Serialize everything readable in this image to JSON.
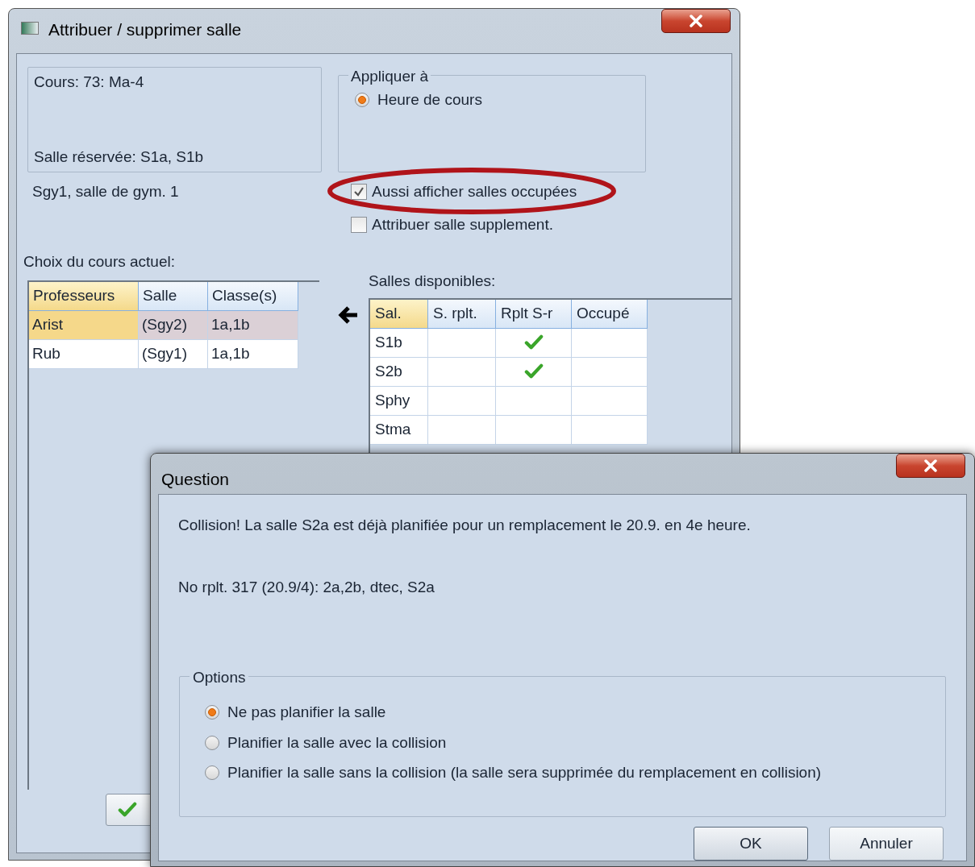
{
  "window": {
    "title": "Attribuer / supprimer salle"
  },
  "course_box": {
    "course": "Cours: 73: Ma-4",
    "reserved": "Salle réservée: S1a, S1b"
  },
  "room_note": "Sgy1, salle de gym. 1",
  "apply_to": {
    "legend": "Appliquer à",
    "options": [
      {
        "label": "Heure de cours",
        "selected": true
      }
    ]
  },
  "checkboxes": [
    {
      "label": "Aussi afficher salles occupées",
      "checked": true,
      "highlighted": true
    },
    {
      "label": "Attribuer salle supplement.",
      "checked": false,
      "highlighted": false
    }
  ],
  "current_course": {
    "label": "Choix du cours actuel:",
    "columns": [
      "Professeurs",
      "Salle",
      "Classe(s)"
    ],
    "rows": [
      {
        "cells": [
          "Arist",
          "(Sgy2)",
          "1a,1b"
        ],
        "selected": true
      },
      {
        "cells": [
          "Rub",
          "(Sgy1)",
          "1a,1b"
        ],
        "selected": false
      }
    ]
  },
  "available_rooms": {
    "label": "Salles disponibles:",
    "columns": [
      "Sal.",
      "S. rplt.",
      "Rplt S-r",
      "Occupé"
    ],
    "rows": [
      {
        "name": "S1b",
        "rplt": false,
        "rplt_sr": true,
        "occupied": false
      },
      {
        "name": "S2b",
        "rplt": false,
        "rplt_sr": true,
        "occupied": false
      },
      {
        "name": "Sphy",
        "rplt": false,
        "rplt_sr": false,
        "occupied": false
      },
      {
        "name": "Stma",
        "rplt": false,
        "rplt_sr": false,
        "occupied": false
      }
    ]
  },
  "dialog": {
    "title": "Question",
    "message": "Collision! La salle S2a est déjà planifiée pour un remplacement le 20.9. en 4e heure.",
    "detail": "No rplt. 317 (20.9/4): 2a,2b, dtec, S2a",
    "options_legend": "Options",
    "options": [
      {
        "label": "Ne pas planifier la salle",
        "selected": true
      },
      {
        "label": "Planifier la salle avec la collision",
        "selected": false
      },
      {
        "label": "Planifier la salle sans la collision (la salle sera supprimée du remplacement en collision)",
        "selected": false
      }
    ],
    "buttons": [
      {
        "label": "OK",
        "kind": "default"
      },
      {
        "label": "Annuler",
        "kind": "normal"
      }
    ]
  }
}
